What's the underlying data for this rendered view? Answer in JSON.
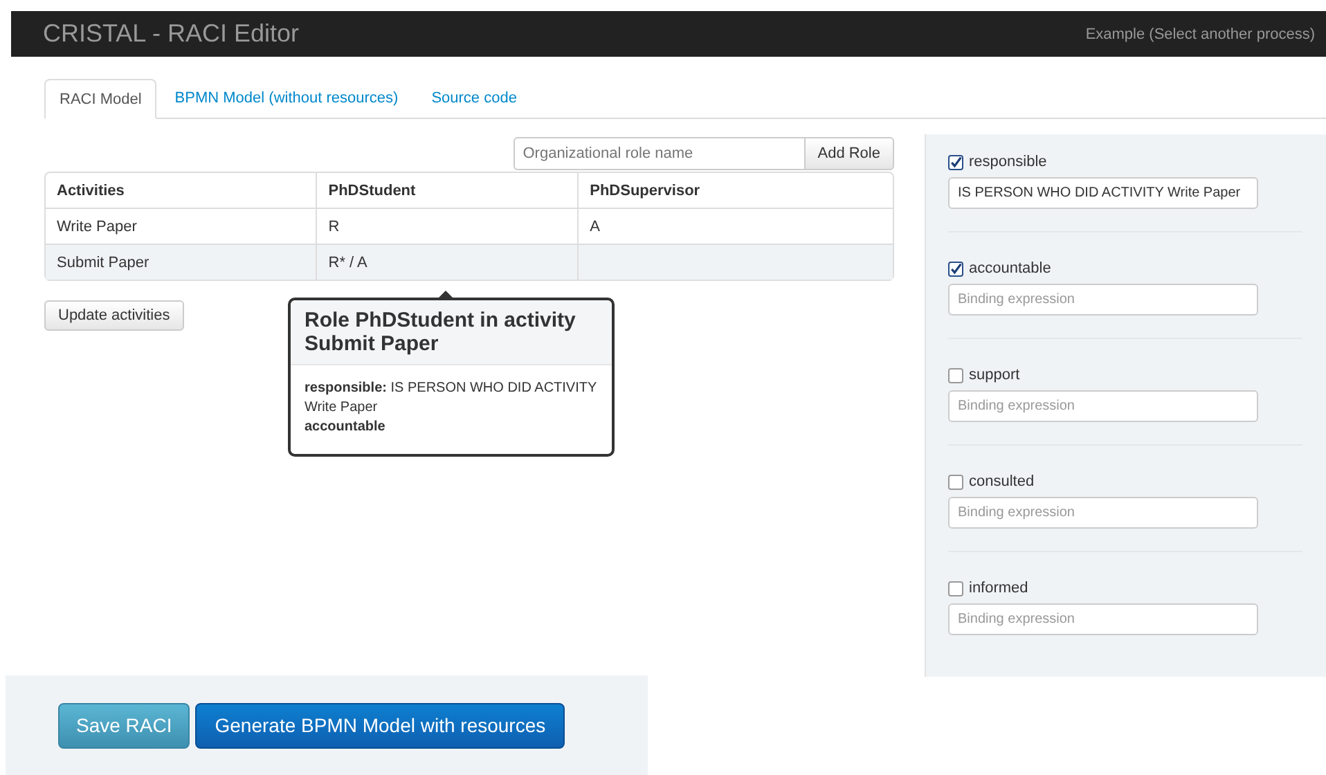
{
  "navbar": {
    "title": "CRISTAL - RACI Editor",
    "link": "Example (Select another process)"
  },
  "tabs": [
    {
      "label": "RACI Model",
      "selected": true
    },
    {
      "label": "BPMN Model (without resources)",
      "selected": false
    },
    {
      "label": "Source code",
      "selected": false
    }
  ],
  "role_field": {
    "placeholder": "Organizational role name"
  },
  "add_role_button": "Add Role",
  "table": {
    "columns": [
      "Activities",
      "PhDStudent",
      "PhDSupervisor"
    ],
    "rows": [
      {
        "cells": [
          "Write Paper",
          "R",
          "A"
        ],
        "selected": false
      },
      {
        "cells": [
          "Submit Paper",
          "R* / A",
          ""
        ],
        "selected": true
      }
    ]
  },
  "update_button": "Update activities",
  "popover": {
    "title": "Role PhDStudent in activity Submit Paper",
    "lines": [
      "**responsible:** IS PERSON WHO DID ACTIVITY Write Paper",
      "**accountable**"
    ]
  },
  "bindings": [
    {
      "label": "responsible",
      "checked": true,
      "value": "IS PERSON WHO DID ACTIVITY Write Paper"
    },
    {
      "label": "accountable",
      "checked": true,
      "placeholder": "Binding expression"
    },
    {
      "label": "support",
      "checked": false,
      "placeholder": "Binding expression"
    },
    {
      "label": "consulted",
      "checked": false,
      "placeholder": "Binding expression"
    },
    {
      "label": "informed",
      "checked": false,
      "placeholder": "Binding expression"
    }
  ],
  "actions": {
    "save": "Save RACI",
    "generate": "Generate BPMN Model with resources"
  }
}
